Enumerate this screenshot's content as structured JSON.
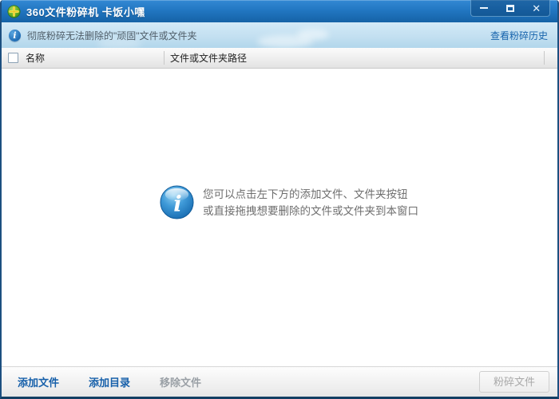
{
  "window": {
    "title": "360文件粉碎机 卡饭小嘿",
    "controls": {
      "minimize": "minimize",
      "maximize": "maximize",
      "close_glyph": "✕"
    }
  },
  "icons": {
    "app_logo": "green-circle-plus-360-logo",
    "info_small": "blue-circle-i",
    "info_large": "glossy-blue-circle-i",
    "info_glyph": "i"
  },
  "info_bar": {
    "text": "彻底粉碎无法删除的\"顽固\"文件或文件夹",
    "history_link": "查看粉碎历史"
  },
  "table": {
    "select_all_checked": false,
    "columns": [
      {
        "label": "名称"
      },
      {
        "label": "文件或文件夹路径"
      }
    ],
    "rows": []
  },
  "empty_state": {
    "line1": "您可以点击左下方的添加文件、文件夹按钮",
    "line2": "或直接拖拽想要删除的文件或文件夹到本窗口"
  },
  "footer": {
    "add_file": "添加文件",
    "add_dir": "添加目录",
    "remove_file": "移除文件",
    "shred": "粉碎文件"
  },
  "colors": {
    "titlebar_blue": "#2277c2",
    "window_border": "#1c4f80",
    "infobar_blue": "#c3e0f1",
    "link_blue": "#1663ac",
    "hint_text": "#6e6e6e",
    "disabled_text": "#9aa0a6"
  }
}
